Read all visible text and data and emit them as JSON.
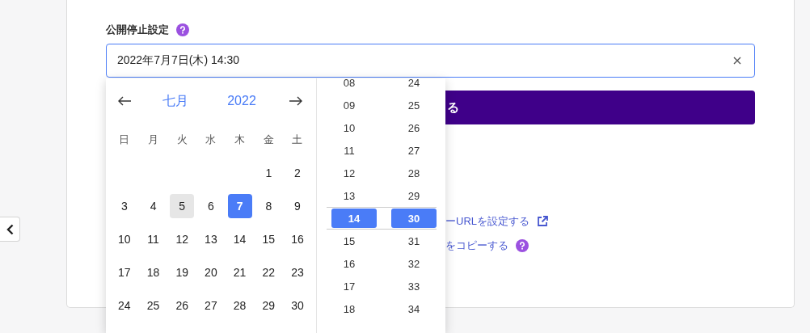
{
  "field_label": "公開停止設定",
  "datetime_field": {
    "value": "2022年7月7日(木) 14:30"
  },
  "submit_button": {
    "label": "る"
  },
  "links": [
    {
      "label": "ーURLを設定する",
      "kind": "external"
    },
    {
      "label": "をコピーする",
      "kind": "help"
    }
  ],
  "calendar": {
    "month": "七月",
    "year": "2022",
    "weekdays": [
      "日",
      "月",
      "火",
      "水",
      "木",
      "金",
      "土"
    ],
    "weeks": [
      [
        {
          "day": "1",
          "selected": false,
          "hovered": false
        },
        {
          "day": "2",
          "selected": false,
          "hovered": false
        }
      ],
      [
        {
          "day": "3",
          "selected": false,
          "hovered": false
        },
        {
          "day": "4",
          "selected": false,
          "hovered": false
        },
        {
          "day": "5",
          "selected": false,
          "hovered": true
        },
        {
          "day": "6",
          "selected": false,
          "hovered": false
        },
        {
          "day": "7",
          "selected": true,
          "hovered": false
        },
        {
          "day": "8",
          "selected": false,
          "hovered": false
        },
        {
          "day": "9",
          "selected": false,
          "hovered": false
        }
      ],
      [
        {
          "day": "10",
          "selected": false,
          "hovered": false
        },
        {
          "day": "11",
          "selected": false,
          "hovered": false
        },
        {
          "day": "12",
          "selected": false,
          "hovered": false
        },
        {
          "day": "13",
          "selected": false,
          "hovered": false
        },
        {
          "day": "14",
          "selected": false,
          "hovered": false
        },
        {
          "day": "15",
          "selected": false,
          "hovered": false
        },
        {
          "day": "16",
          "selected": false,
          "hovered": false
        }
      ],
      [
        {
          "day": "17",
          "selected": false,
          "hovered": false
        },
        {
          "day": "18",
          "selected": false,
          "hovered": false
        },
        {
          "day": "19",
          "selected": false,
          "hovered": false
        },
        {
          "day": "20",
          "selected": false,
          "hovered": false
        },
        {
          "day": "21",
          "selected": false,
          "hovered": false
        },
        {
          "day": "22",
          "selected": false,
          "hovered": false
        },
        {
          "day": "23",
          "selected": false,
          "hovered": false
        }
      ],
      [
        {
          "day": "24",
          "selected": false,
          "hovered": false
        },
        {
          "day": "25",
          "selected": false,
          "hovered": false
        },
        {
          "day": "26",
          "selected": false,
          "hovered": false
        },
        {
          "day": "27",
          "selected": false,
          "hovered": false
        },
        {
          "day": "28",
          "selected": false,
          "hovered": false
        },
        {
          "day": "29",
          "selected": false,
          "hovered": false
        },
        {
          "day": "30",
          "selected": false,
          "hovered": false
        }
      ]
    ]
  },
  "time": {
    "hours": [
      {
        "label": "08",
        "selected": false
      },
      {
        "label": "09",
        "selected": false
      },
      {
        "label": "10",
        "selected": false
      },
      {
        "label": "11",
        "selected": false
      },
      {
        "label": "12",
        "selected": false
      },
      {
        "label": "13",
        "selected": false
      },
      {
        "label": "14",
        "selected": true
      },
      {
        "label": "15",
        "selected": false
      },
      {
        "label": "16",
        "selected": false
      },
      {
        "label": "17",
        "selected": false
      },
      {
        "label": "18",
        "selected": false
      }
    ],
    "minutes": [
      {
        "label": "24",
        "selected": false
      },
      {
        "label": "25",
        "selected": false
      },
      {
        "label": "26",
        "selected": false
      },
      {
        "label": "27",
        "selected": false
      },
      {
        "label": "28",
        "selected": false
      },
      {
        "label": "29",
        "selected": false
      },
      {
        "label": "30",
        "selected": true
      },
      {
        "label": "31",
        "selected": false
      },
      {
        "label": "32",
        "selected": false
      },
      {
        "label": "33",
        "selected": false
      },
      {
        "label": "34",
        "selected": false
      }
    ]
  }
}
